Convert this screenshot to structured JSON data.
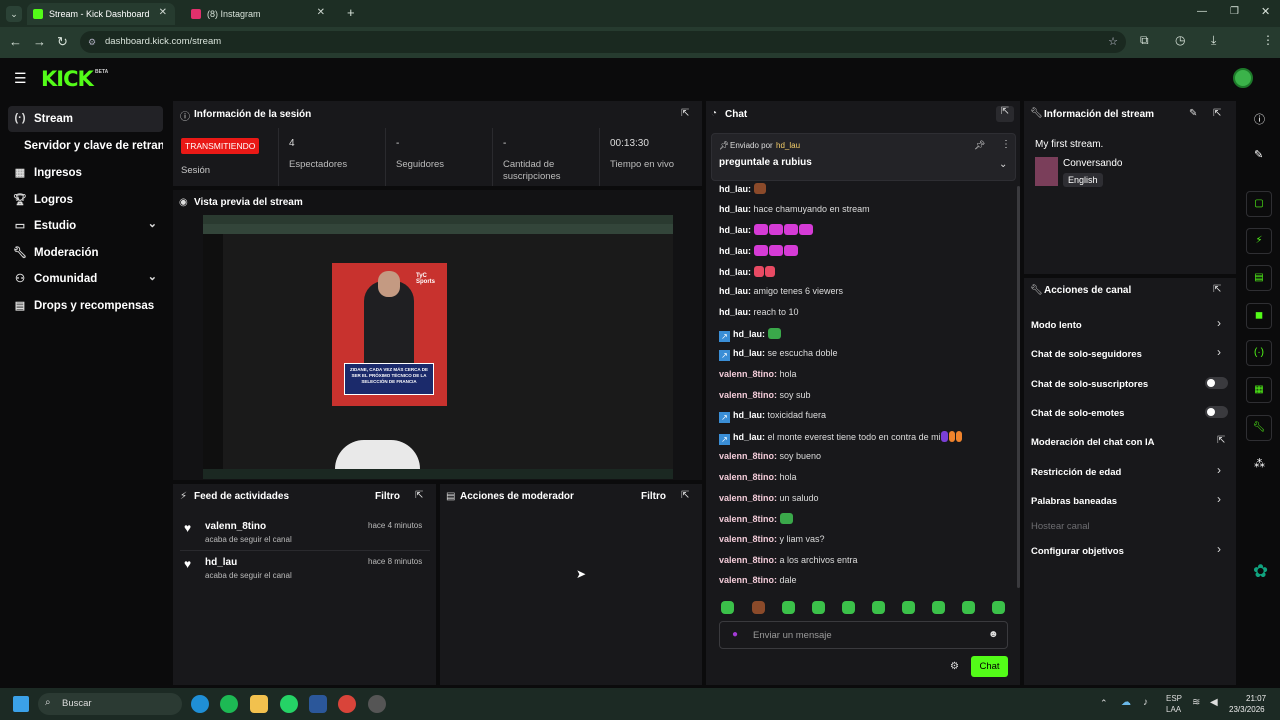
{
  "browser": {
    "tabs": [
      {
        "title": "Stream - Kick Dashboard"
      },
      {
        "title": "(8) Instagram"
      }
    ],
    "url": "dashboard.kick.com/stream"
  },
  "kick": {
    "logo": "KICK",
    "beta": "BETA"
  },
  "sidebar": {
    "items": [
      {
        "label": "Stream",
        "icon": "broadcast-icon"
      },
      {
        "label": "Servidor y clave de retransmisión",
        "icon": ""
      },
      {
        "label": "Ingresos",
        "icon": "revenue-icon"
      },
      {
        "label": "Logros",
        "icon": "trophy-icon"
      },
      {
        "label": "Estudio",
        "icon": "studio-icon"
      },
      {
        "label": "Moderación",
        "icon": "wrench-icon"
      },
      {
        "label": "Comunidad",
        "icon": "community-icon"
      },
      {
        "label": "Drops y recompensas",
        "icon": "drops-icon"
      }
    ]
  },
  "session": {
    "title": "Información de la sesión",
    "status": "TRANSMITIENDO",
    "status_label": "Sesión",
    "stats": [
      {
        "value": "4",
        "label": "Espectadores"
      },
      {
        "value": "-",
        "label": "Seguidores"
      },
      {
        "value": "-",
        "label": "Cantidad de suscripciones"
      },
      {
        "value": "00:13:30",
        "label": "Tiempo en vivo"
      }
    ]
  },
  "preview": {
    "title": "Vista previa del stream",
    "post_tag": "TyC Sports",
    "post_caption": "ZIDANE, CADA VEZ MÁS CERCA DE SER EL PRÓXIMO TÉCNICO DE LA SELECCIÓN DE FRANCIA"
  },
  "activity": {
    "title": "Feed de actividades",
    "filter": "Filtro",
    "items": [
      {
        "user": "valenn_8tino",
        "action": "acaba de seguir el canal",
        "time": "hace 4 minutos"
      },
      {
        "user": "hd_lau",
        "action": "acaba de seguir el canal",
        "time": "hace 8 minutos"
      }
    ]
  },
  "modactions": {
    "title": "Acciones de moderador",
    "filter": "Filtro"
  },
  "chat": {
    "title": "Chat",
    "pinned_by_label": "Enviado por",
    "pinned_by": "hd_lau",
    "pinned_message": "preguntale a rubius",
    "messages": [
      {
        "user": "hd_lau",
        "text": "",
        "mod": false,
        "emotes": [
          "brown"
        ]
      },
      {
        "user": "hd_lau",
        "text": "hace chamuyando en stream",
        "mod": false,
        "emotes": []
      },
      {
        "user": "hd_lau",
        "text": "",
        "mod": false,
        "emotes": [
          "pink",
          "pink",
          "pink",
          "pink"
        ]
      },
      {
        "user": "hd_lau",
        "text": "",
        "mod": false,
        "emotes": [
          "pink",
          "pink",
          "pink"
        ]
      },
      {
        "user": "hd_lau",
        "text": "",
        "mod": false,
        "emotes": [
          "red",
          "red"
        ]
      },
      {
        "user": "hd_lau",
        "text": "amigo tenes 6 viewers",
        "mod": false,
        "emotes": []
      },
      {
        "user": "hd_lau",
        "text": "reach to 10",
        "mod": false,
        "emotes": []
      },
      {
        "user": "hd_lau",
        "text": "",
        "mod": true,
        "emotes": [
          "green"
        ]
      },
      {
        "user": "hd_lau",
        "text": "se escucha doble",
        "mod": true,
        "emotes": []
      },
      {
        "user": "valenn_8tino",
        "text": "hola",
        "mod": false,
        "emotes": []
      },
      {
        "user": "valenn_8tino",
        "text": "soy sub",
        "mod": false,
        "emotes": []
      },
      {
        "user": "hd_lau",
        "text": "toxicidad fuera",
        "mod": true,
        "emotes": []
      },
      {
        "user": "hd_lau",
        "text": "el monte everest tiene todo en contra de mi",
        "mod": true,
        "emotes": [
          "violet",
          "fire",
          "fire"
        ]
      },
      {
        "user": "valenn_8tino",
        "text": "soy bueno",
        "mod": false,
        "emotes": []
      },
      {
        "user": "valenn_8tino",
        "text": "hola",
        "mod": false,
        "emotes": []
      },
      {
        "user": "valenn_8tino",
        "text": "un saludo",
        "mod": false,
        "emotes": []
      },
      {
        "user": "valenn_8tino",
        "text": "",
        "mod": false,
        "emotes": [
          "green"
        ]
      },
      {
        "user": "valenn_8tino",
        "text": "y liam vas?",
        "mod": false,
        "emotes": []
      },
      {
        "user": "valenn_8tino",
        "text": "a los archivos entra",
        "mod": false,
        "emotes": []
      },
      {
        "user": "valenn_8tino",
        "text": "dale",
        "mod": false,
        "emotes": []
      }
    ],
    "input_placeholder": "Enviar un mensaje",
    "send_label": "Chat"
  },
  "streaminfo": {
    "title": "Información del stream",
    "stream_title": "My first stream.",
    "category": "Conversando",
    "language": "English"
  },
  "channel_actions": {
    "title": "Acciones de canal",
    "items": [
      {
        "label": "Modo lento",
        "control": "chevron"
      },
      {
        "label": "Chat de solo-seguidores",
        "control": "chevron"
      },
      {
        "label": "Chat de solo-suscriptores",
        "control": "toggle"
      },
      {
        "label": "Chat de solo-emotes",
        "control": "toggle"
      },
      {
        "label": "Moderación del chat con IA",
        "control": "external"
      },
      {
        "label": "Restricción de edad",
        "control": "chevron"
      },
      {
        "label": "Palabras baneadas",
        "control": "chevron"
      },
      {
        "label": "Hostear canal",
        "control": "none"
      },
      {
        "label": "Configurar objetivos",
        "control": "chevron"
      }
    ]
  },
  "taskbar": {
    "search": "Buscar",
    "lang": "ESP",
    "lang2": "LAA",
    "time": "21:07",
    "date": "23/3/2026"
  },
  "colors": {
    "kick_green": "#53fc18",
    "live_red": "#e91916",
    "panel": "#18181b"
  }
}
